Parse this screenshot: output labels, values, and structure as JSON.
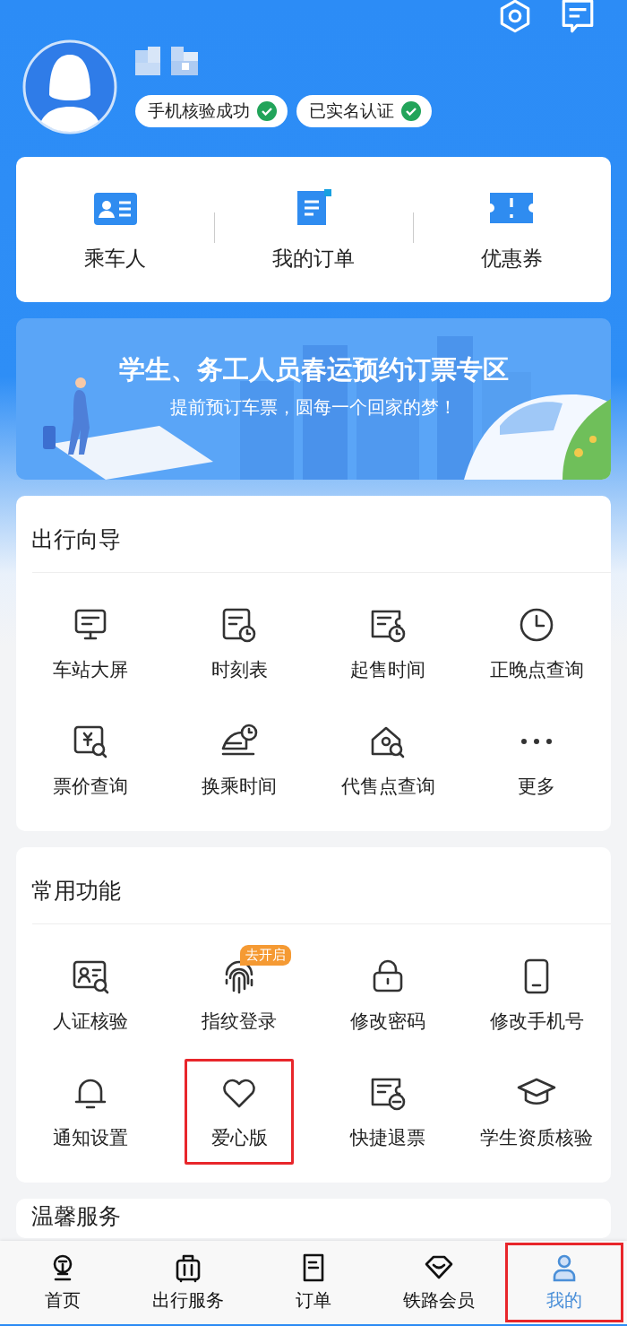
{
  "profile": {
    "badges": [
      {
        "label": "手机核验成功",
        "verified": true
      },
      {
        "label": "已实名认证",
        "verified": true
      }
    ]
  },
  "shortcuts": [
    {
      "label": "乘车人"
    },
    {
      "label": "我的订单"
    },
    {
      "label": "优惠券"
    }
  ],
  "banner": {
    "title": "学生、务工人员春运预约订票专区",
    "subtitle": "提前预订车票，圆每一个回家的梦！"
  },
  "sections": [
    {
      "title": "出行向导",
      "items": [
        {
          "label": "车站大屏",
          "highlighted": false
        },
        {
          "label": "时刻表",
          "highlighted": false
        },
        {
          "label": "起售时间",
          "highlighted": false
        },
        {
          "label": "正晚点查询",
          "highlighted": false
        },
        {
          "label": "票价查询",
          "highlighted": false
        },
        {
          "label": "换乘时间",
          "highlighted": false
        },
        {
          "label": "代售点查询",
          "highlighted": false
        },
        {
          "label": "更多",
          "highlighted": false
        }
      ]
    },
    {
      "title": "常用功能",
      "items": [
        {
          "label": "人证核验",
          "highlighted": false
        },
        {
          "label": "指纹登录",
          "highlighted": false,
          "badge": "去开启"
        },
        {
          "label": "修改密码",
          "highlighted": false
        },
        {
          "label": "修改手机号",
          "highlighted": false
        },
        {
          "label": "通知设置",
          "highlighted": false
        },
        {
          "label": "爱心版",
          "highlighted": true
        },
        {
          "label": "快捷退票",
          "highlighted": false
        },
        {
          "label": "学生资质核验",
          "highlighted": false
        }
      ]
    },
    {
      "title": "温馨服务"
    }
  ],
  "tab_bar": [
    {
      "label": "首页",
      "selected": false,
      "highlighted": false
    },
    {
      "label": "出行服务",
      "selected": false,
      "highlighted": false
    },
    {
      "label": "订单",
      "selected": false,
      "highlighted": false
    },
    {
      "label": "铁路会员",
      "selected": false,
      "highlighted": false
    },
    {
      "label": "我的",
      "selected": true,
      "highlighted": true
    }
  ]
}
